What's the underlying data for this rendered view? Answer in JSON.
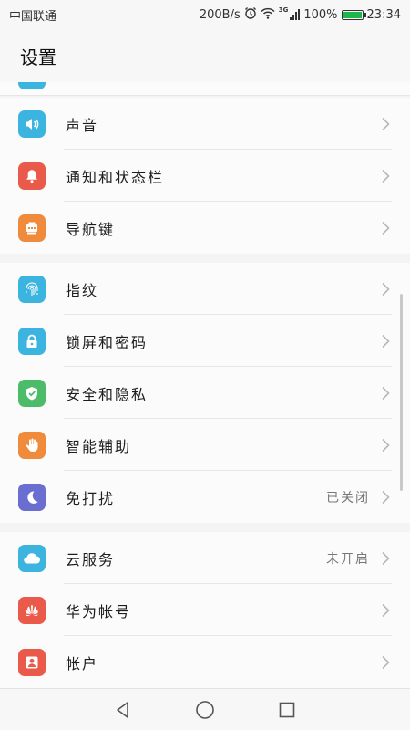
{
  "status_bar": {
    "carrier": "中国联通",
    "speed": "200B/s",
    "network": "3G",
    "battery": "100%",
    "battery_level": 1.0,
    "time": "23:34"
  },
  "header": {
    "title": "设置"
  },
  "settings": {
    "group1": [
      {
        "label": "声音",
        "icon": "speaker-icon",
        "color": "#3cb4e0"
      },
      {
        "label": "通知和状态栏",
        "icon": "bell-icon",
        "color": "#ea5a4b"
      },
      {
        "label": "导航键",
        "icon": "navigation-keys-icon",
        "color": "#ef8b3a"
      }
    ],
    "group2": [
      {
        "label": "指纹",
        "icon": "fingerprint-icon",
        "color": "#3cb4e0"
      },
      {
        "label": "锁屏和密码",
        "icon": "lock-icon",
        "color": "#3cb4e0"
      },
      {
        "label": "安全和隐私",
        "icon": "shield-check-icon",
        "color": "#4cbc6a"
      },
      {
        "label": "智能辅助",
        "icon": "hand-icon",
        "color": "#ef8b3a"
      },
      {
        "label": "免打扰",
        "icon": "moon-icon",
        "color": "#6a6ed0",
        "value": "已关闭"
      }
    ],
    "group3": [
      {
        "label": "云服务",
        "icon": "cloud-icon",
        "color": "#3cb4e0",
        "value": "未开启"
      },
      {
        "label": "华为帐号",
        "icon": "huawei-logo-icon",
        "color": "#ea5a4b"
      },
      {
        "label": "帐户",
        "icon": "account-icon",
        "color": "#ea5a4b"
      }
    ]
  }
}
